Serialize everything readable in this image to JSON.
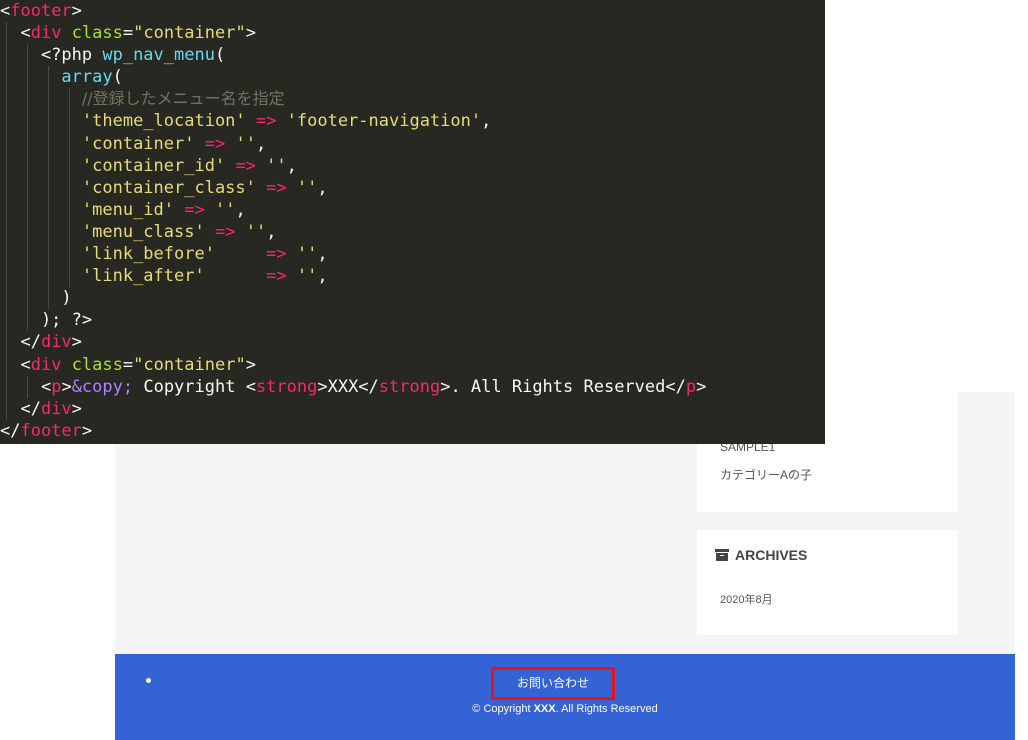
{
  "code": {
    "lines": [
      {
        "guides": 0,
        "tokens": [
          {
            "c": "t-plain",
            "t": "<"
          },
          {
            "c": "t-tag",
            "t": "footer"
          },
          {
            "c": "t-plain",
            "t": ">"
          }
        ]
      },
      {
        "guides": 1,
        "tokens": [
          {
            "c": "t-plain",
            "t": "  <"
          },
          {
            "c": "t-tag",
            "t": "div"
          },
          {
            "c": "t-plain",
            "t": " "
          },
          {
            "c": "t-attr",
            "t": "class"
          },
          {
            "c": "t-plain",
            "t": "="
          },
          {
            "c": "t-str",
            "t": "\"container\""
          },
          {
            "c": "t-plain",
            "t": ">"
          }
        ]
      },
      {
        "guides": 2,
        "tokens": [
          {
            "c": "t-plain",
            "t": "    <?php "
          },
          {
            "c": "t-fn",
            "t": "wp_nav_menu"
          },
          {
            "c": "t-plain",
            "t": "("
          }
        ]
      },
      {
        "guides": 3,
        "tokens": [
          {
            "c": "t-plain",
            "t": "      "
          },
          {
            "c": "t-kw",
            "t": "array"
          },
          {
            "c": "t-plain",
            "t": "("
          }
        ]
      },
      {
        "guides": 4,
        "tokens": [
          {
            "c": "t-plain",
            "t": "        "
          },
          {
            "c": "t-com",
            "t": "//登録したメニュー名を指定"
          }
        ]
      },
      {
        "guides": 4,
        "tokens": [
          {
            "c": "t-plain",
            "t": "        "
          },
          {
            "c": "t-str",
            "t": "'theme_location'"
          },
          {
            "c": "t-plain",
            "t": " "
          },
          {
            "c": "t-op",
            "t": "=>"
          },
          {
            "c": "t-plain",
            "t": " "
          },
          {
            "c": "t-str",
            "t": "'footer-navigation'"
          },
          {
            "c": "t-plain",
            "t": ","
          }
        ]
      },
      {
        "guides": 4,
        "tokens": [
          {
            "c": "t-plain",
            "t": "        "
          },
          {
            "c": "t-str",
            "t": "'container'"
          },
          {
            "c": "t-plain",
            "t": " "
          },
          {
            "c": "t-op",
            "t": "=>"
          },
          {
            "c": "t-plain",
            "t": " "
          },
          {
            "c": "t-str",
            "t": "''"
          },
          {
            "c": "t-plain",
            "t": ","
          }
        ]
      },
      {
        "guides": 4,
        "tokens": [
          {
            "c": "t-plain",
            "t": "        "
          },
          {
            "c": "t-str",
            "t": "'container_id'"
          },
          {
            "c": "t-plain",
            "t": " "
          },
          {
            "c": "t-op",
            "t": "=>"
          },
          {
            "c": "t-plain",
            "t": " "
          },
          {
            "c": "t-str",
            "t": "''"
          },
          {
            "c": "t-plain",
            "t": ","
          }
        ]
      },
      {
        "guides": 4,
        "tokens": [
          {
            "c": "t-plain",
            "t": "        "
          },
          {
            "c": "t-str",
            "t": "'container_class'"
          },
          {
            "c": "t-plain",
            "t": " "
          },
          {
            "c": "t-op",
            "t": "=>"
          },
          {
            "c": "t-plain",
            "t": " "
          },
          {
            "c": "t-str",
            "t": "''"
          },
          {
            "c": "t-plain",
            "t": ","
          }
        ]
      },
      {
        "guides": 4,
        "tokens": [
          {
            "c": "t-plain",
            "t": "        "
          },
          {
            "c": "t-str",
            "t": "'menu_id'"
          },
          {
            "c": "t-plain",
            "t": " "
          },
          {
            "c": "t-op",
            "t": "=>"
          },
          {
            "c": "t-plain",
            "t": " "
          },
          {
            "c": "t-str",
            "t": "''"
          },
          {
            "c": "t-plain",
            "t": ","
          }
        ]
      },
      {
        "guides": 4,
        "tokens": [
          {
            "c": "t-plain",
            "t": "        "
          },
          {
            "c": "t-str",
            "t": "'menu_class'"
          },
          {
            "c": "t-plain",
            "t": " "
          },
          {
            "c": "t-op",
            "t": "=>"
          },
          {
            "c": "t-plain",
            "t": " "
          },
          {
            "c": "t-str",
            "t": "''"
          },
          {
            "c": "t-plain",
            "t": ","
          }
        ]
      },
      {
        "guides": 4,
        "tokens": [
          {
            "c": "t-plain",
            "t": "        "
          },
          {
            "c": "t-str",
            "t": "'link_before'"
          },
          {
            "c": "t-plain",
            "t": "     "
          },
          {
            "c": "t-op",
            "t": "=>"
          },
          {
            "c": "t-plain",
            "t": " "
          },
          {
            "c": "t-str",
            "t": "''"
          },
          {
            "c": "t-plain",
            "t": ","
          }
        ]
      },
      {
        "guides": 4,
        "tokens": [
          {
            "c": "t-plain",
            "t": "        "
          },
          {
            "c": "t-str",
            "t": "'link_after'"
          },
          {
            "c": "t-plain",
            "t": "      "
          },
          {
            "c": "t-op",
            "t": "=>"
          },
          {
            "c": "t-plain",
            "t": " "
          },
          {
            "c": "t-str",
            "t": "''"
          },
          {
            "c": "t-plain",
            "t": ","
          }
        ]
      },
      {
        "guides": 3,
        "tokens": [
          {
            "c": "t-plain",
            "t": "      )"
          }
        ]
      },
      {
        "guides": 2,
        "tokens": [
          {
            "c": "t-plain",
            "t": "    ); ?>"
          }
        ]
      },
      {
        "guides": 1,
        "tokens": [
          {
            "c": "t-plain",
            "t": "  </"
          },
          {
            "c": "t-tag",
            "t": "div"
          },
          {
            "c": "t-plain",
            "t": ">"
          }
        ]
      },
      {
        "guides": 1,
        "tokens": [
          {
            "c": "t-plain",
            "t": "  <"
          },
          {
            "c": "t-tag",
            "t": "div"
          },
          {
            "c": "t-plain",
            "t": " "
          },
          {
            "c": "t-attr",
            "t": "class"
          },
          {
            "c": "t-plain",
            "t": "="
          },
          {
            "c": "t-str",
            "t": "\"container\""
          },
          {
            "c": "t-plain",
            "t": ">"
          }
        ]
      },
      {
        "guides": 2,
        "tokens": [
          {
            "c": "t-plain",
            "t": "    <"
          },
          {
            "c": "t-tag",
            "t": "p"
          },
          {
            "c": "t-plain",
            "t": ">"
          },
          {
            "c": "t-ent",
            "t": "&copy;"
          },
          {
            "c": "t-plain",
            "t": " Copyright <"
          },
          {
            "c": "t-tag",
            "t": "strong"
          },
          {
            "c": "t-plain",
            "t": ">XXX</"
          },
          {
            "c": "t-tag",
            "t": "strong"
          },
          {
            "c": "t-plain",
            "t": ">. All Rights Reserved</"
          },
          {
            "c": "t-tag",
            "t": "p"
          },
          {
            "c": "t-plain",
            "t": ">"
          }
        ]
      },
      {
        "guides": 1,
        "tokens": [
          {
            "c": "t-plain",
            "t": "  </"
          },
          {
            "c": "t-tag",
            "t": "div"
          },
          {
            "c": "t-plain",
            "t": ">"
          }
        ]
      },
      {
        "guides": 0,
        "tokens": [
          {
            "c": "t-plain",
            "t": "</"
          },
          {
            "c": "t-tag",
            "t": "footer"
          },
          {
            "c": "t-plain",
            "t": ">"
          }
        ]
      }
    ]
  },
  "sidebar": {
    "category_partial": "SAMPLE1",
    "category_item": "カテゴリーAの子",
    "archives_title": "ARCHIVES",
    "archives_icon": "archive-icon",
    "archive_item": "2020年8月"
  },
  "footer": {
    "nav_link": "お問い合わせ",
    "copyright_prefix": "© Copyright ",
    "copyright_owner": "XXX",
    "copyright_suffix": ". All Rights Reserved",
    "bar_color": "#3563d6",
    "highlight_color": "#e8141c"
  }
}
